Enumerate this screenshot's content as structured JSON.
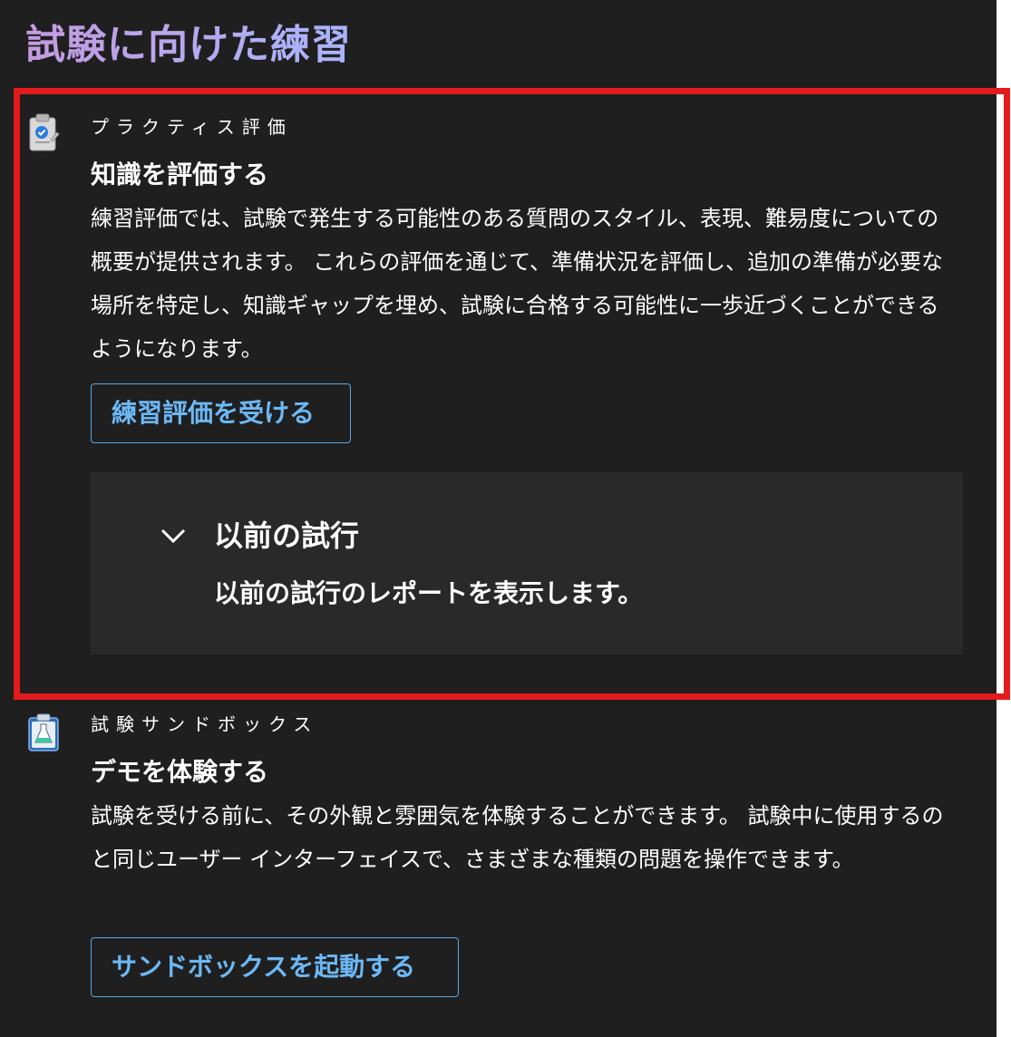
{
  "page": {
    "title": "試験に向けた練習"
  },
  "practice": {
    "kicker": "プラクティス評価",
    "heading": "知識を評価する",
    "body": "練習評価では、試験で発生する可能性のある質問のスタイル、表現、難易度についての概要が提供されます。 これらの評価を通じて、準備状況を評価し、追加の準備が必要な場所を特定し、知識ギャップを埋め、試験に合格する可能性に一歩近づくことができるようになります。",
    "button_label": "練習評価を受ける",
    "icon": "clipboard-check-icon",
    "previous_attempts": {
      "title": "以前の試行",
      "subtitle": "以前の試行のレポートを表示します。",
      "expanded": false
    }
  },
  "sandbox": {
    "kicker": "試験サンドボックス",
    "heading": "デモを体験する",
    "body": "試験を受ける前に、その外観と雰囲気を体験することができます。 試験中に使用するのと同じユーザー インターフェイスで、さまざまな種類の問題を操作できます。",
    "button_label": "サンドボックスを起動する",
    "icon": "flask-clipboard-icon"
  },
  "colors": {
    "background": "#1f1f1f",
    "accent_link": "#6cb8f5",
    "highlight_border": "#e31b1b",
    "attempts_panel": "#292929"
  }
}
